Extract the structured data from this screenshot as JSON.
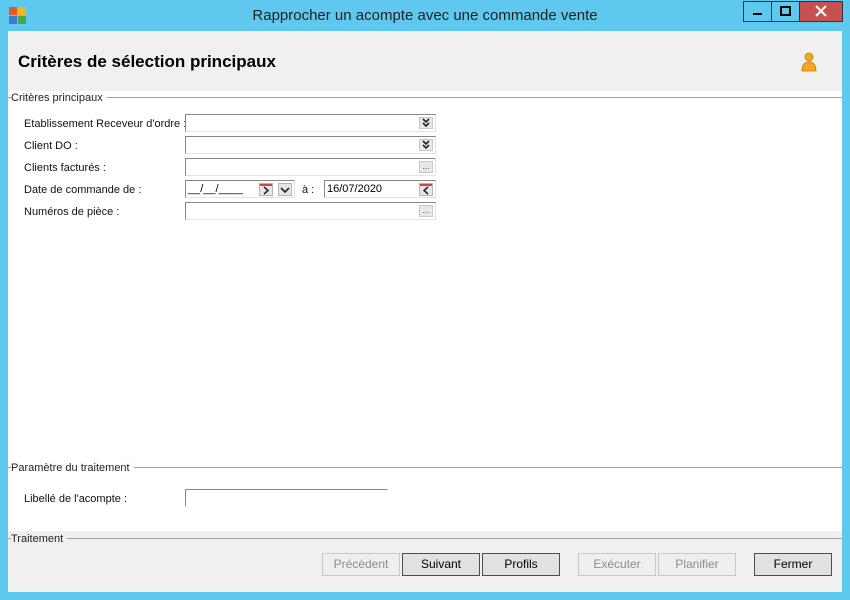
{
  "window": {
    "title": "Rapprocher un acompte avec une commande vente",
    "accent": "#5fc8ef",
    "close_color": "#c75050"
  },
  "header": {
    "title": "Critères de sélection principaux"
  },
  "main_criteria": {
    "section_label": "Critères principaux",
    "fields": [
      {
        "label": "Etablissement Receveur d'ordre :",
        "value": ""
      },
      {
        "label": "Client DO :",
        "value": ""
      },
      {
        "label": "Clients facturés :",
        "value": ""
      },
      {
        "label": "Date de commande de :",
        "value": "__/__/____"
      },
      {
        "label": "Numéros de pièce :",
        "value": ""
      }
    ],
    "date_to_label": "à :",
    "date_to_value": "16/07/2020"
  },
  "processing_params": {
    "section_label": "Paramètre du traitement",
    "acompte_label": "Libellé de l'acompte :",
    "acompte_value": ""
  },
  "footer": {
    "section_label": "Traitement",
    "buttons": {
      "previous": "Précédent",
      "next": "Suivant",
      "profiles": "Profils",
      "execute": "Exécuter",
      "schedule": "Planifier",
      "close": "Fermer"
    }
  },
  "icons": {
    "ellipsis": "...",
    "user": "user-icon",
    "combo": "double-chevron-down-icon"
  }
}
